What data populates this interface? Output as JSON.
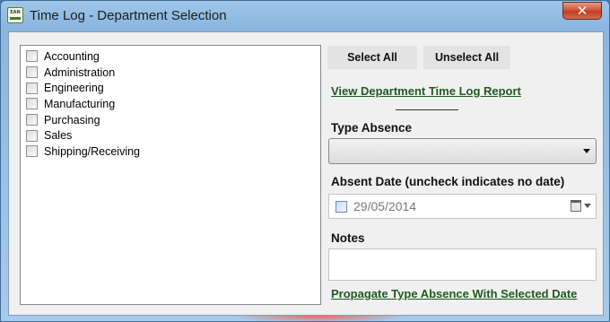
{
  "window": {
    "title": "Time Log - Department Selection",
    "app_icon_text": "EAN",
    "close_glyph": "✕"
  },
  "departments": [
    {
      "label": "Accounting",
      "checked": false
    },
    {
      "label": "Administration",
      "checked": false
    },
    {
      "label": "Engineering",
      "checked": false
    },
    {
      "label": "Manufacturing",
      "checked": false
    },
    {
      "label": "Purchasing",
      "checked": false
    },
    {
      "label": "Sales",
      "checked": false
    },
    {
      "label": "Shipping/Receiving",
      "checked": false
    }
  ],
  "buttons": {
    "select_all": "Select All",
    "unselect_all": "Unselect All"
  },
  "links": {
    "view_report": "View Department Time Log Report",
    "propagate": "Propagate Type Absence With Selected Date"
  },
  "type_absence": {
    "label": "Type Absence",
    "value": ""
  },
  "absent_date": {
    "label": "Absent Date (uncheck indicates no date)",
    "value": "29/05/2014",
    "checked": false
  },
  "notes": {
    "label": "Notes",
    "value": ""
  },
  "colors": {
    "link": "#1e5b1e",
    "title_bar": "#9fc6e8",
    "close_button": "#c13e22"
  }
}
